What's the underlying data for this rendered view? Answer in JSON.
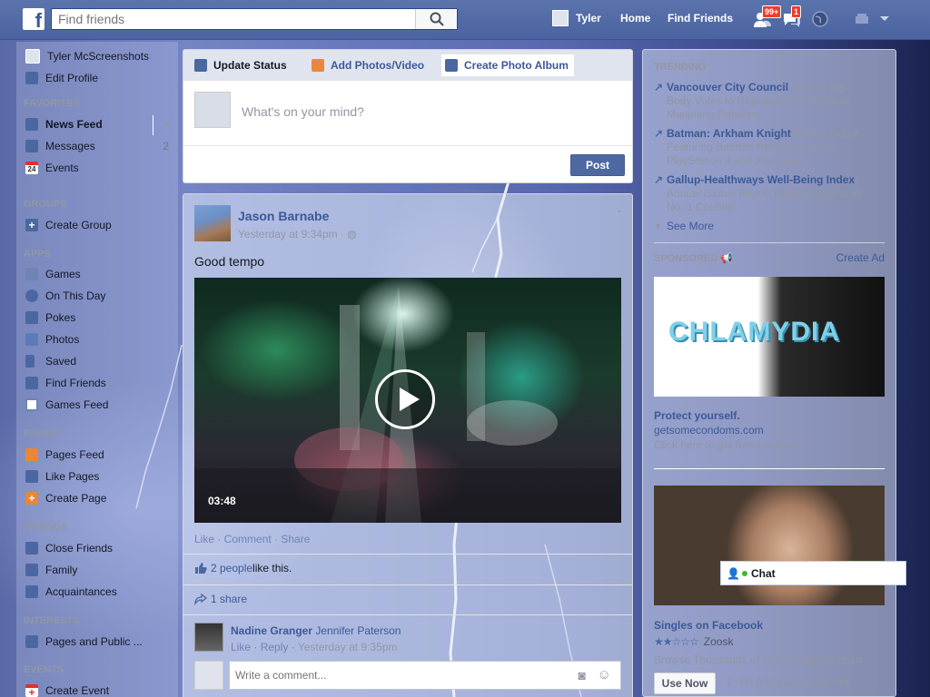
{
  "topbar": {
    "logo": "f",
    "search_placeholder": "Find friends",
    "user_name": "Tyler",
    "home": "Home",
    "find_friends": "Find Friends",
    "friend_requests_badge": "99+",
    "messages_badge": "1"
  },
  "leftnav": {
    "profile_name": "Tyler McScreenshots",
    "edit_profile": "Edit Profile",
    "favorites_head": "FAVORITES",
    "news_feed": "News Feed",
    "messages": "Messages",
    "messages_count": "2",
    "events": "Events",
    "groups_head": "GROUPS",
    "create_group": "Create Group",
    "apps_head": "APPS",
    "games": "Games",
    "on_this_day": "On This Day",
    "pokes": "Pokes",
    "photos": "Photos",
    "saved": "Saved",
    "find_friends": "Find Friends",
    "games_feed": "Games Feed",
    "pages_head": "PAGES",
    "pages_feed": "Pages Feed",
    "like_pages": "Like Pages",
    "create_page": "Create Page",
    "friends_head": "FRIENDS",
    "close_friends": "Close Friends",
    "family": "Family",
    "acquaintances": "Acquaintances",
    "interests_head": "INTERESTS",
    "pages_public": "Pages and Public ...",
    "events_head": "EVENTS",
    "create_event": "Create Event"
  },
  "composer": {
    "tab_status": "Update Status",
    "tab_photos": "Add Photos/Video",
    "tab_album": "Create Photo Album",
    "placeholder": "What's on your mind?",
    "post_button": "Post"
  },
  "story": {
    "author": "Jason Barnabe",
    "timestamp": "Yesterday at 9:34pm · ",
    "text": "Good tempo",
    "duration": "03:48",
    "actions": "Like · Comment · Share",
    "likes_link": "2 people",
    "likes_suffix": " like this.",
    "shares": "1 share",
    "comment_author": "Nadine Granger",
    "comment_text": "Jennifer Paterson",
    "comment_like": "Like",
    "comment_reply": "Reply",
    "comment_time": "Yesterday at 9:35pm",
    "write_placeholder": "Write a comment..."
  },
  "right": {
    "trending_head": "TRENDING",
    "trends": [
      {
        "title": "Vancouver City Council",
        "sep": ": ",
        "text": "Governing Body Votes to Regulate City's Medical Marijuana Retailers"
      },
      {
        "title": "Batman: Arkham Knight",
        "sep": ": ",
        "text": "Action Game Featuring Batman Released on PC, PlayStation 4 and Xbox One"
      },
      {
        "title": "Gallup-Healthways Well-Being Index",
        "sep": ": ",
        "text": "Annual Global Report Ranks Panama as No. 1 Country"
      }
    ],
    "see_more": "See More",
    "sponsored_head": "SPONSORED",
    "create_ad": "Create Ad",
    "ad1_word": "CHLAMYDIA",
    "ad1_title": "Protect yourself.",
    "ad1_link": "getsomecondoms.com",
    "ad1_desc": "Click here to get free condoms.",
    "ad2_title": "Singles on Facebook",
    "ad2_source": "Zoosk",
    "ad2_desc": "Browse Thousands of Local Single Women",
    "use_now": "Use Now",
    "use_count": "· 1,000,000 people use this",
    "stars": "★★☆☆☆",
    "rating": 2.5
  },
  "chat": {
    "label": "Chat"
  },
  "colors": {
    "brand": "#3b5998",
    "topbar": "#4e69a2",
    "badge": "#f03d25"
  }
}
